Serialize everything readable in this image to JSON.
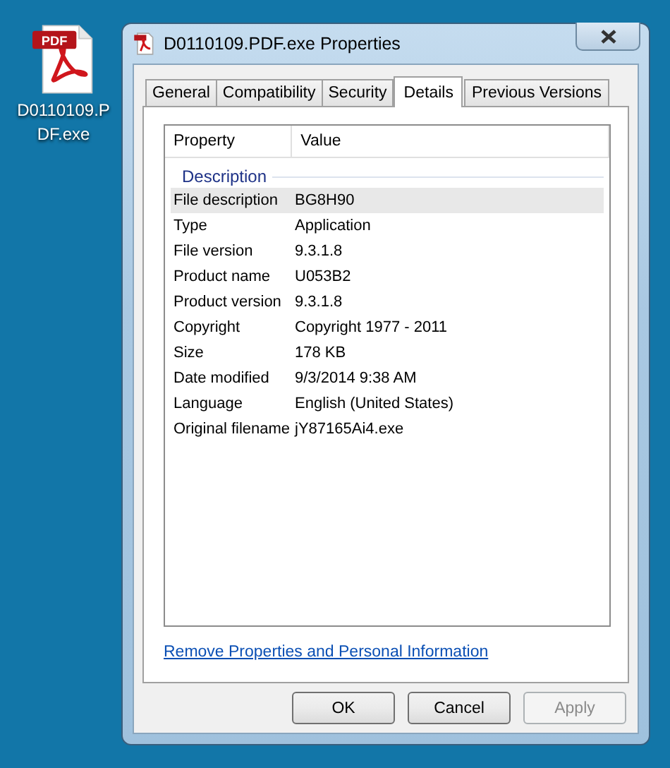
{
  "desktop_icon": {
    "label": "D0110109.PDF.exe",
    "badge": "PDF"
  },
  "window": {
    "title": "D0110109.PDF.exe Properties"
  },
  "tabs": [
    {
      "label": "General",
      "selected": false
    },
    {
      "label": "Compatibility",
      "selected": false
    },
    {
      "label": "Security",
      "selected": false
    },
    {
      "label": "Details",
      "selected": true
    },
    {
      "label": "Previous Versions",
      "selected": false
    }
  ],
  "table": {
    "columns": [
      "Property",
      "Value"
    ],
    "group": "Description",
    "rows": [
      {
        "property": "File description",
        "value": "BG8H90",
        "selected": true
      },
      {
        "property": "Type",
        "value": "Application",
        "selected": false
      },
      {
        "property": "File version",
        "value": "9.3.1.8",
        "selected": false
      },
      {
        "property": "Product name",
        "value": "U053B2",
        "selected": false
      },
      {
        "property": "Product version",
        "value": "9.3.1.8",
        "selected": false
      },
      {
        "property": "Copyright",
        "value": "Copyright 1977 - 2011",
        "selected": false
      },
      {
        "property": "Size",
        "value": "178 KB",
        "selected": false
      },
      {
        "property": "Date modified",
        "value": "9/3/2014 9:38 AM",
        "selected": false
      },
      {
        "property": "Language",
        "value": "English (United States)",
        "selected": false
      },
      {
        "property": "Original filename",
        "value": "jY87165Ai4.exe",
        "selected": false
      }
    ]
  },
  "link": "Remove Properties and Personal Information",
  "buttons": [
    {
      "label": "OK",
      "disabled": false
    },
    {
      "label": "Cancel",
      "disabled": false
    },
    {
      "label": "Apply",
      "disabled": true
    }
  ]
}
